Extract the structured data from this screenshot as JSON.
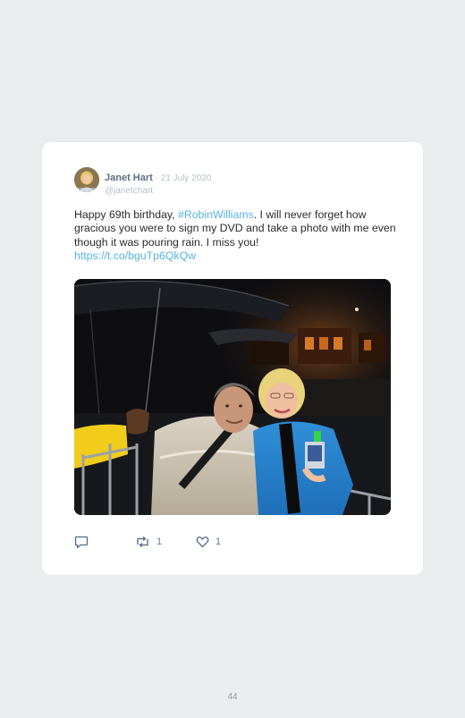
{
  "tweet": {
    "author_name": "Janet Hart",
    "separator": " · ",
    "date": "21 July 2020",
    "handle": "@janetchart",
    "text_prefix": "Happy 69th birthday, ",
    "hashtag": "#RobinWilliams",
    "text_body": ". I will never forget how gracious you were to sign my DVD and take a photo with me even though it was pouring rain. I miss you!",
    "link": "https://t.co/bguTp6QkQw",
    "photo_description_icon": "photo",
    "reply_count": "",
    "retweet_count": "1",
    "like_count": "1"
  },
  "actions": {
    "reply_icon": "speech-bubble-icon",
    "retweet_icon": "retweet-arrows-icon",
    "like_icon": "heart-icon"
  },
  "colors": {
    "background": "#ebecee",
    "card": "#ffffff",
    "name": "#5b6f86",
    "muted": "#b7c0cc",
    "link": "#56b2e5",
    "text": "#2b2b2b"
  },
  "page": {
    "number": "44"
  }
}
